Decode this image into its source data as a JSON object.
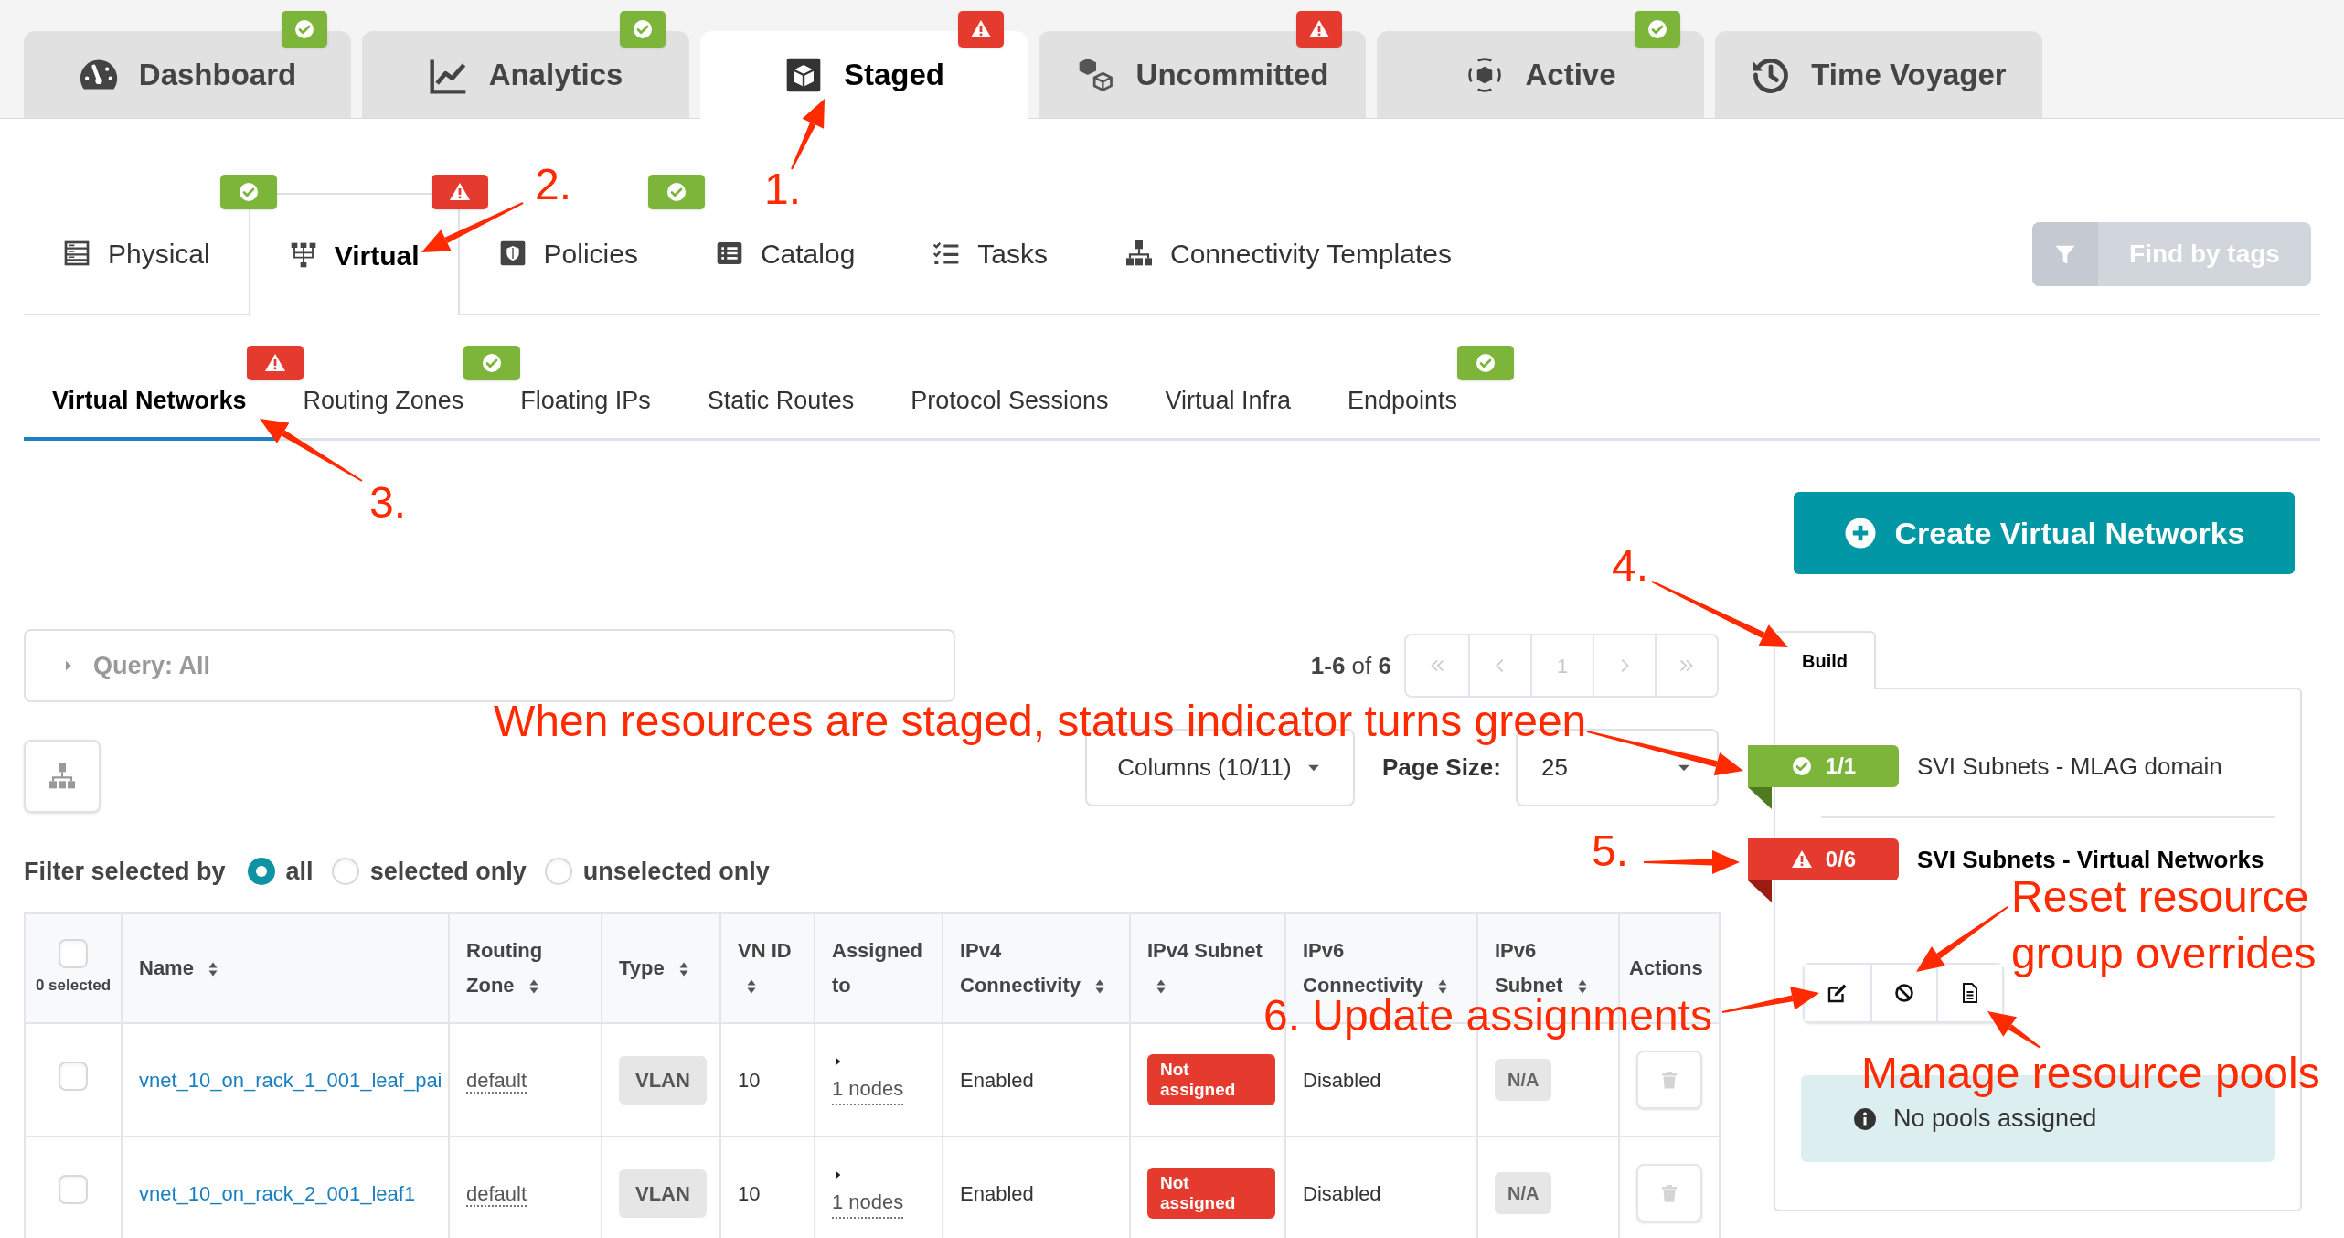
{
  "main_tabs": [
    {
      "label": "Dashboard",
      "selected": false,
      "kind": "ok"
    },
    {
      "label": "Analytics",
      "selected": false,
      "kind": "ok"
    },
    {
      "label": "Staged",
      "selected": true,
      "kind": "warning"
    },
    {
      "label": "Uncommitted",
      "selected": false,
      "kind": "warning"
    },
    {
      "label": "Active",
      "selected": false,
      "kind": "ok"
    },
    {
      "label": "Time Voyager",
      "selected": false
    }
  ],
  "sub_tabs": [
    {
      "label": "Physical",
      "selected": false,
      "kind": "ok"
    },
    {
      "label": "Virtual",
      "selected": true,
      "kind": "warning"
    },
    {
      "label": "Policies",
      "selected": false,
      "kind": "ok"
    },
    {
      "label": "Catalog",
      "selected": false
    },
    {
      "label": "Tasks",
      "selected": false
    },
    {
      "label": "Connectivity Templates",
      "selected": false
    }
  ],
  "find_by_tags": {
    "label": "Find by tags",
    "disabled": true
  },
  "section_tabs": [
    {
      "label": "Virtual Networks",
      "selected": true,
      "kind": "warning"
    },
    {
      "label": "Routing Zones",
      "selected": false,
      "kind": "ok"
    },
    {
      "label": "Floating IPs",
      "selected": false
    },
    {
      "label": "Static Routes",
      "selected": false
    },
    {
      "label": "Protocol Sessions",
      "selected": false
    },
    {
      "label": "Virtual Infra",
      "selected": false
    },
    {
      "label": "Endpoints",
      "selected": false,
      "kind": "ok"
    }
  ],
  "create_button": "Create Virtual Networks",
  "query": "Query: All",
  "pagination": {
    "summary": "**1-6** of **6**",
    "page": "1"
  },
  "columns_button": "Columns (10/11)",
  "page_size": {
    "label": "Page Size:",
    "value": "25"
  },
  "filter": {
    "label": "Filter selected by",
    "options": [
      {
        "label": "all",
        "selected": true
      },
      {
        "label": "selected only",
        "selected": false
      },
      {
        "label": "unselected only",
        "selected": false
      }
    ]
  },
  "table": {
    "selected_count": "0 selected",
    "select_all_checked": false,
    "columns": [
      {
        "label": "Name",
        "sortable": true
      },
      {
        "label": "Routing Zone",
        "sortable": true
      },
      {
        "label": "Type",
        "sortable": true
      },
      {
        "label": "VN ID",
        "sortable": true
      },
      {
        "label": "Assigned to",
        "sortable": false
      },
      {
        "label": "IPv4 Connectivity",
        "sortable": true
      },
      {
        "label": "IPv4 Subnet",
        "sortable": true
      },
      {
        "label": "IPv6 Connectivity",
        "sortable": true
      },
      {
        "label": "IPv6 Subnet",
        "sortable": true
      },
      {
        "label": "Actions",
        "sortable": false
      }
    ],
    "rows": [
      {
        "checked": false,
        "name": "vnet_10_on_rack_1_001_leaf_pai",
        "routing_zone": "default",
        "type": "VLAN",
        "vn_id": "10",
        "assigned_to": "1 nodes",
        "ipv4_connectivity": "Enabled",
        "ipv4_subnet": "Not assigned",
        "ipv6_connectivity": "Disabled",
        "ipv6_subnet": "N/A"
      },
      {
        "checked": false,
        "name": "vnet_10_on_rack_2_001_leaf1",
        "routing_zone": "default",
        "type": "VLAN",
        "vn_id": "10",
        "assigned_to": "1 nodes",
        "ipv4_connectivity": "Enabled",
        "ipv4_subnet": "Not assigned",
        "ipv6_connectivity": "Disabled",
        "ipv6_subnet": "N/A"
      }
    ]
  },
  "build_panel": {
    "tab": "Build",
    "resource_groups": [
      {
        "kind": "ok",
        "count": "1/1",
        "label": "SVI Subnets - MLAG domain",
        "selected": false
      },
      {
        "kind": "warning",
        "count": "0/6",
        "label": "SVI Subnets - Virtual Networks",
        "selected": true
      }
    ],
    "pools_message": "No pools assigned"
  },
  "annotations": [
    {
      "text": "1."
    },
    {
      "text": "2."
    },
    {
      "text": "3."
    },
    {
      "text": "4."
    },
    {
      "text": "When resources are staged, status indicator turns green"
    },
    {
      "text": "5."
    },
    {
      "text": "Reset resource group overrides"
    },
    {
      "text": "6. Update assignments"
    },
    {
      "text": "Manage resource pools"
    }
  ]
}
